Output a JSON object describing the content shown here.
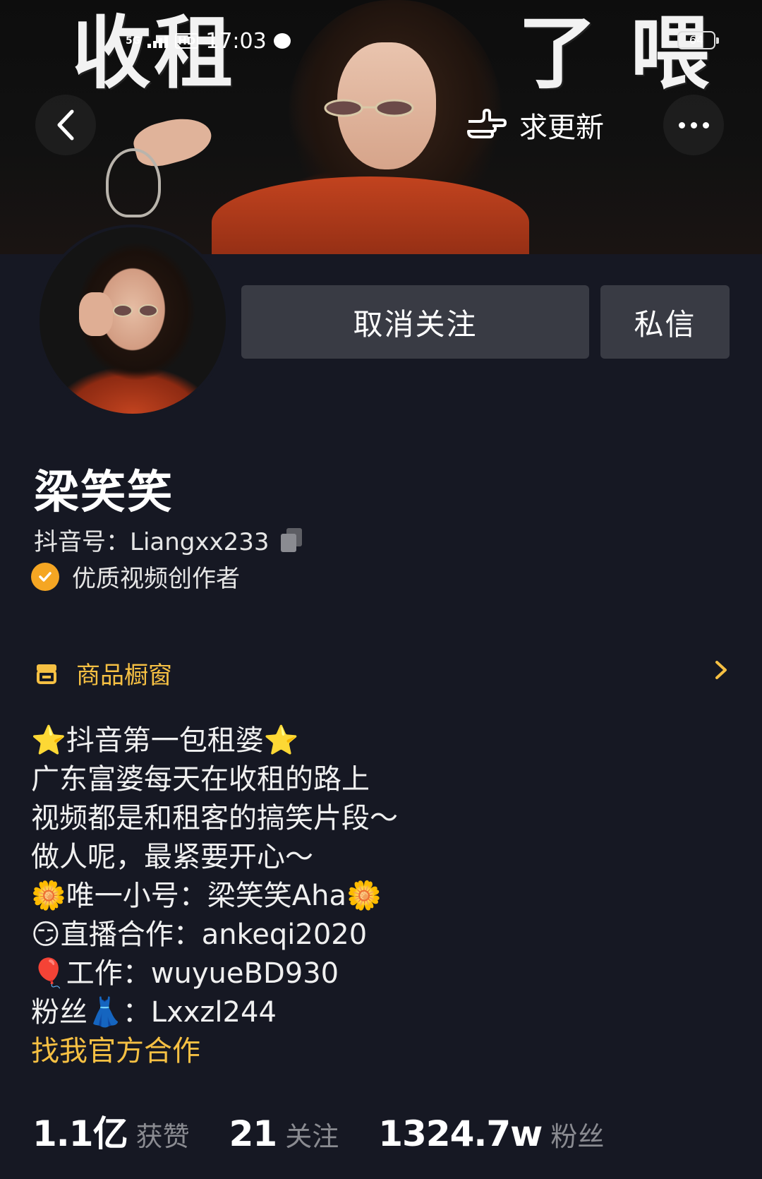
{
  "banner": {
    "title_left": "收租",
    "title_right": "了 喂",
    "update_label": "求更新"
  },
  "status_bar": {
    "network": "5G",
    "time": "17:03",
    "battery": "64"
  },
  "actions": {
    "unfollow_label": "取消关注",
    "message_label": "私信"
  },
  "profile": {
    "name": "梁笑笑",
    "douyin_id": "抖音号：Liangxx233",
    "verified_label": "优质视频创作者"
  },
  "shop": {
    "label": "商品橱窗"
  },
  "bio": {
    "lines": [
      "⭐抖音第一包租婆⭐",
      "广东富婆每天在收租的路上",
      "视频都是和租客的搞笑片段～",
      "做人呢，最紧要开心～",
      "🌼唯一小号：梁笑笑Aha🌼",
      "😏直播合作：ankeqi2020",
      "🎈工作：wuyueBD930",
      "粉丝👗：Lxxzl244"
    ],
    "link": "找我官方合作"
  },
  "stats": [
    {
      "value": "1.1亿",
      "label": "获赞"
    },
    {
      "value": "21",
      "label": "关注"
    },
    {
      "value": "1324.7w",
      "label": "粉丝"
    }
  ],
  "colors": {
    "background": "#161823",
    "button": "#393b44",
    "accent_yellow": "#f6c043",
    "verified_orange": "#f5a623"
  },
  "icons": {
    "back": "chevron-left-icon",
    "more": "more-dots-icon",
    "update": "pointing-hand-icon",
    "copy": "copy-icon",
    "verified": "check-badge-icon",
    "shop": "shop-icon",
    "shop_arrow": "chevron-right-icon"
  }
}
